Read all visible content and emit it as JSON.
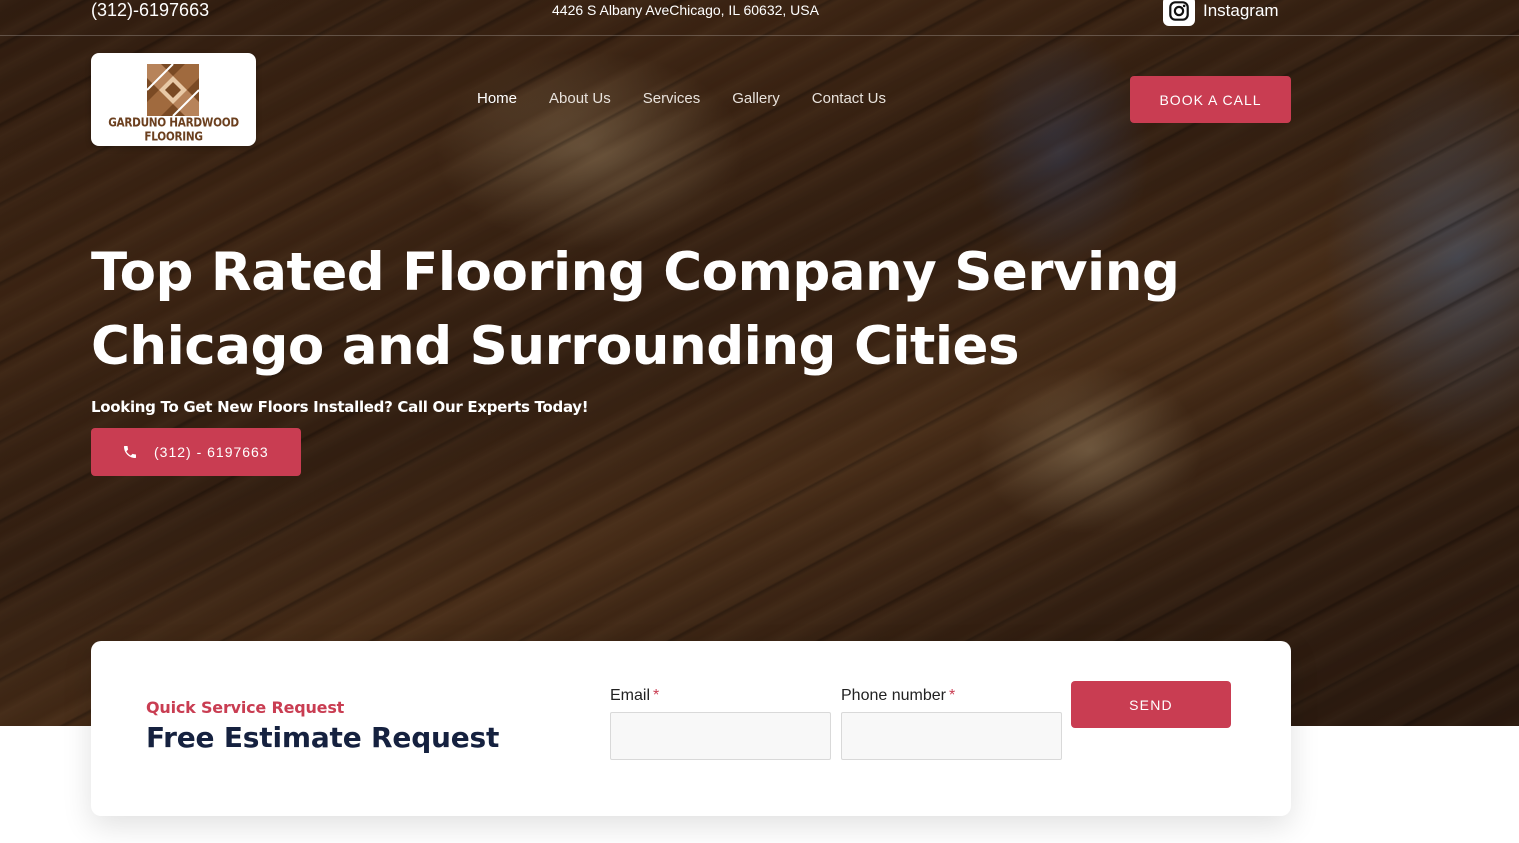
{
  "topbar": {
    "phone": "(312)-6197663",
    "address": "4426 S Albany AveChicago, IL 60632, USA",
    "instagram_label": "Instagram",
    "instagram_icon": "instagram-icon"
  },
  "logo": {
    "text": "GARDUNO HARDWOOD FLOORING"
  },
  "nav": {
    "items": [
      {
        "label": "Home",
        "active": true
      },
      {
        "label": "About Us"
      },
      {
        "label": "Services"
      },
      {
        "label": "Gallery"
      },
      {
        "label": "Contact Us"
      }
    ],
    "cta_label": "BOOK A CALL"
  },
  "hero": {
    "title_line1": "Top Rated Flooring Company Serving",
    "title_line2": "Chicago and Surrounding Cities",
    "subtitle": "Looking To Get New Floors Installed? Call Our Experts Today!",
    "call_button_label": "(312) - 6197663",
    "call_icon": "phone-icon"
  },
  "form": {
    "eyebrow": "Quick Service Request",
    "title": "Free Estimate Request",
    "email_label": "Email",
    "phone_label": "Phone number",
    "required_marker": "*",
    "email_value": "",
    "phone_value": "",
    "send_label": "SEND"
  },
  "colors": {
    "accent": "#c93d52",
    "heading_dark": "#15213f",
    "logo_brown": "#6b3f1e"
  }
}
